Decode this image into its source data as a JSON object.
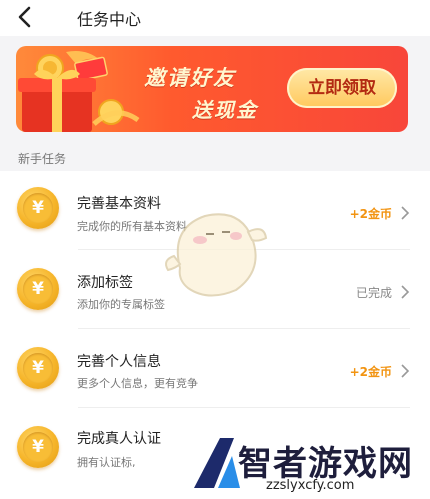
{
  "header": {
    "title": "任务中心"
  },
  "banner": {
    "line1": "邀请好友",
    "line2": "送现金",
    "button_label": "立即领取"
  },
  "section": {
    "label": "新手任务"
  },
  "tasks": [
    {
      "title": "完善基本资料",
      "desc": "完成你的所有基本资料",
      "status": "+2金币",
      "status_type": "reward",
      "coin_symbol": "¥"
    },
    {
      "title": "添加标签",
      "desc": "添加你的专属标签",
      "status": "已完成",
      "status_type": "done",
      "coin_symbol": "¥"
    },
    {
      "title": "完善个人信息",
      "desc": "更多个人信息，更有竞争",
      "status": "+2金币",
      "status_type": "reward",
      "coin_symbol": "¥"
    },
    {
      "title": "完成真人认证",
      "desc": "拥有认证标,",
      "status": "",
      "status_type": "reward",
      "coin_symbol": "¥"
    }
  ],
  "watermark": {
    "name": "智者游戏网",
    "url": "zzslyxcfy.com"
  },
  "colors": {
    "accent_reward": "#f29412",
    "banner_red": "#f8463a",
    "banner_orange": "#ff8a3a"
  }
}
